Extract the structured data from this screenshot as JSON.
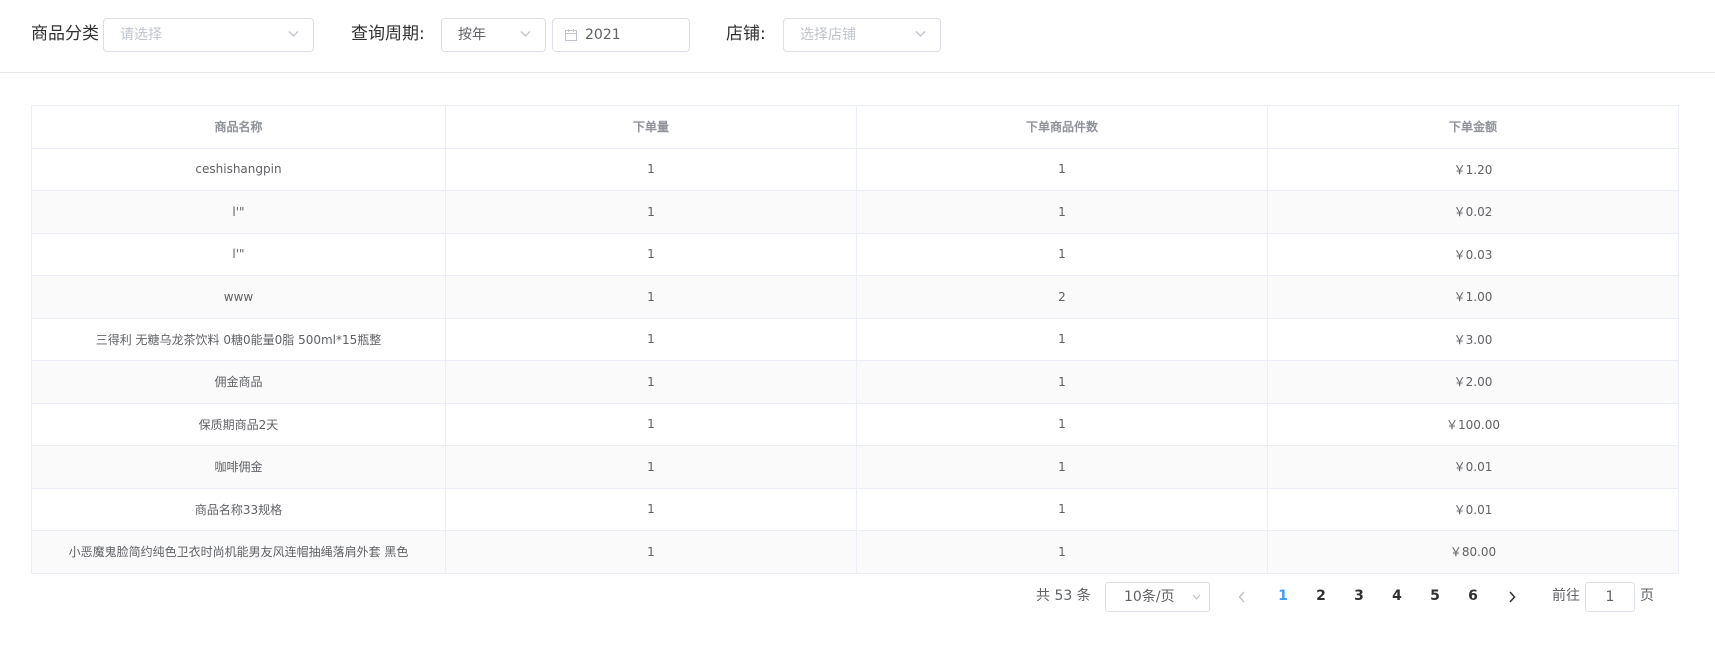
{
  "filters": {
    "category": {
      "label": "商品分类",
      "placeholder": "请选择"
    },
    "period": {
      "label": "查询周期:",
      "mode": "按年",
      "date": "2021"
    },
    "shop": {
      "label": "店铺:",
      "placeholder": "选择店铺"
    }
  },
  "icons": {
    "chevron": "chevron-down-icon",
    "calendar": "calendar-icon",
    "prev": "chevron-left-icon",
    "next": "chevron-right-icon"
  },
  "colors": {
    "accent": "#409eff",
    "border": "#ebeef5",
    "stripe": "#fafafa"
  },
  "table": {
    "columns": [
      "商品名称",
      "下单量",
      "下单商品件数",
      "下单金额"
    ],
    "rows": [
      [
        "ceshishangpin",
        "1",
        "1",
        "￥1.20"
      ],
      [
        "l'\"",
        "1",
        "1",
        "￥0.02"
      ],
      [
        "l'\"",
        "1",
        "1",
        "￥0.03"
      ],
      [
        "www",
        "1",
        "2",
        "￥1.00"
      ],
      [
        "三得利 无糖乌龙茶饮料 0糖0能量0脂 500ml*15瓶整",
        "1",
        "1",
        "￥3.00"
      ],
      [
        "佣金商品",
        "1",
        "1",
        "￥2.00"
      ],
      [
        "保质期商品2天",
        "1",
        "1",
        "￥100.00"
      ],
      [
        "咖啡佣金",
        "1",
        "1",
        "￥0.01"
      ],
      [
        "商品名称33规格",
        "1",
        "1",
        "￥0.01"
      ],
      [
        "小恶魔鬼脸简约纯色卫衣时尚机能男友风连帽抽绳落肩外套 黑色",
        "1",
        "1",
        "￥80.00"
      ]
    ]
  },
  "pagination": {
    "total": "共 53 条",
    "page_size": "10条/页",
    "pages": [
      "1",
      "2",
      "3",
      "4",
      "5",
      "6"
    ],
    "current": "1",
    "goto_prefix": "前往",
    "goto_value": "1",
    "goto_suffix": "页"
  }
}
